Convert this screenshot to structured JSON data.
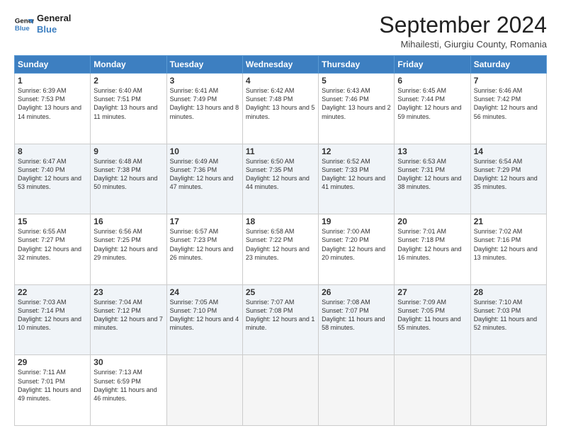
{
  "header": {
    "logo_line1": "General",
    "logo_line2": "Blue",
    "month_title": "September 2024",
    "location": "Mihailesti, Giurgiu County, Romania"
  },
  "weekdays": [
    "Sunday",
    "Monday",
    "Tuesday",
    "Wednesday",
    "Thursday",
    "Friday",
    "Saturday"
  ],
  "weeks": [
    [
      {
        "day": "1",
        "sunrise": "6:39 AM",
        "sunset": "7:53 PM",
        "daylight": "13 hours and 14 minutes."
      },
      {
        "day": "2",
        "sunrise": "6:40 AM",
        "sunset": "7:51 PM",
        "daylight": "13 hours and 11 minutes."
      },
      {
        "day": "3",
        "sunrise": "6:41 AM",
        "sunset": "7:49 PM",
        "daylight": "13 hours and 8 minutes."
      },
      {
        "day": "4",
        "sunrise": "6:42 AM",
        "sunset": "7:48 PM",
        "daylight": "13 hours and 5 minutes."
      },
      {
        "day": "5",
        "sunrise": "6:43 AM",
        "sunset": "7:46 PM",
        "daylight": "13 hours and 2 minutes."
      },
      {
        "day": "6",
        "sunrise": "6:45 AM",
        "sunset": "7:44 PM",
        "daylight": "12 hours and 59 minutes."
      },
      {
        "day": "7",
        "sunrise": "6:46 AM",
        "sunset": "7:42 PM",
        "daylight": "12 hours and 56 minutes."
      }
    ],
    [
      {
        "day": "8",
        "sunrise": "6:47 AM",
        "sunset": "7:40 PM",
        "daylight": "12 hours and 53 minutes."
      },
      {
        "day": "9",
        "sunrise": "6:48 AM",
        "sunset": "7:38 PM",
        "daylight": "12 hours and 50 minutes."
      },
      {
        "day": "10",
        "sunrise": "6:49 AM",
        "sunset": "7:36 PM",
        "daylight": "12 hours and 47 minutes."
      },
      {
        "day": "11",
        "sunrise": "6:50 AM",
        "sunset": "7:35 PM",
        "daylight": "12 hours and 44 minutes."
      },
      {
        "day": "12",
        "sunrise": "6:52 AM",
        "sunset": "7:33 PM",
        "daylight": "12 hours and 41 minutes."
      },
      {
        "day": "13",
        "sunrise": "6:53 AM",
        "sunset": "7:31 PM",
        "daylight": "12 hours and 38 minutes."
      },
      {
        "day": "14",
        "sunrise": "6:54 AM",
        "sunset": "7:29 PM",
        "daylight": "12 hours and 35 minutes."
      }
    ],
    [
      {
        "day": "15",
        "sunrise": "6:55 AM",
        "sunset": "7:27 PM",
        "daylight": "12 hours and 32 minutes."
      },
      {
        "day": "16",
        "sunrise": "6:56 AM",
        "sunset": "7:25 PM",
        "daylight": "12 hours and 29 minutes."
      },
      {
        "day": "17",
        "sunrise": "6:57 AM",
        "sunset": "7:23 PM",
        "daylight": "12 hours and 26 minutes."
      },
      {
        "day": "18",
        "sunrise": "6:58 AM",
        "sunset": "7:22 PM",
        "daylight": "12 hours and 23 minutes."
      },
      {
        "day": "19",
        "sunrise": "7:00 AM",
        "sunset": "7:20 PM",
        "daylight": "12 hours and 20 minutes."
      },
      {
        "day": "20",
        "sunrise": "7:01 AM",
        "sunset": "7:18 PM",
        "daylight": "12 hours and 16 minutes."
      },
      {
        "day": "21",
        "sunrise": "7:02 AM",
        "sunset": "7:16 PM",
        "daylight": "12 hours and 13 minutes."
      }
    ],
    [
      {
        "day": "22",
        "sunrise": "7:03 AM",
        "sunset": "7:14 PM",
        "daylight": "12 hours and 10 minutes."
      },
      {
        "day": "23",
        "sunrise": "7:04 AM",
        "sunset": "7:12 PM",
        "daylight": "12 hours and 7 minutes."
      },
      {
        "day": "24",
        "sunrise": "7:05 AM",
        "sunset": "7:10 PM",
        "daylight": "12 hours and 4 minutes."
      },
      {
        "day": "25",
        "sunrise": "7:07 AM",
        "sunset": "7:08 PM",
        "daylight": "12 hours and 1 minute."
      },
      {
        "day": "26",
        "sunrise": "7:08 AM",
        "sunset": "7:07 PM",
        "daylight": "11 hours and 58 minutes."
      },
      {
        "day": "27",
        "sunrise": "7:09 AM",
        "sunset": "7:05 PM",
        "daylight": "11 hours and 55 minutes."
      },
      {
        "day": "28",
        "sunrise": "7:10 AM",
        "sunset": "7:03 PM",
        "daylight": "11 hours and 52 minutes."
      }
    ],
    [
      {
        "day": "29",
        "sunrise": "7:11 AM",
        "sunset": "7:01 PM",
        "daylight": "11 hours and 49 minutes."
      },
      {
        "day": "30",
        "sunrise": "7:13 AM",
        "sunset": "6:59 PM",
        "daylight": "11 hours and 46 minutes."
      },
      null,
      null,
      null,
      null,
      null
    ]
  ]
}
